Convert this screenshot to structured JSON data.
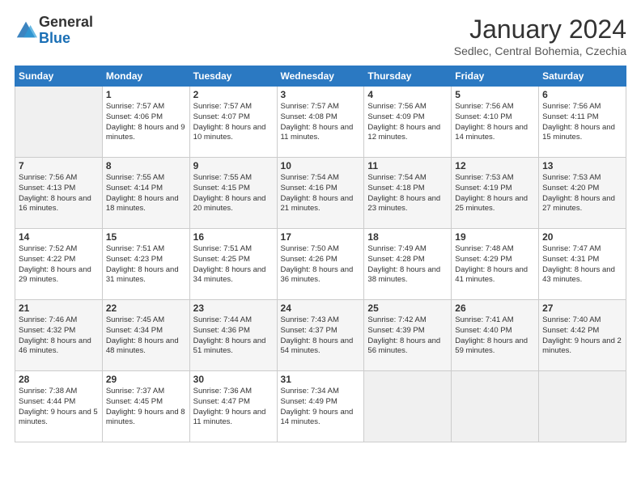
{
  "logo": {
    "general": "General",
    "blue": "Blue"
  },
  "header": {
    "month": "January 2024",
    "location": "Sedlec, Central Bohemia, Czechia"
  },
  "days": [
    "Sunday",
    "Monday",
    "Tuesday",
    "Wednesday",
    "Thursday",
    "Friday",
    "Saturday"
  ],
  "weeks": [
    [
      {
        "num": "",
        "empty": true
      },
      {
        "num": "1",
        "sunrise": "7:57 AM",
        "sunset": "4:06 PM",
        "daylight": "8 hours and 9 minutes."
      },
      {
        "num": "2",
        "sunrise": "7:57 AM",
        "sunset": "4:07 PM",
        "daylight": "8 hours and 10 minutes."
      },
      {
        "num": "3",
        "sunrise": "7:57 AM",
        "sunset": "4:08 PM",
        "daylight": "8 hours and 11 minutes."
      },
      {
        "num": "4",
        "sunrise": "7:56 AM",
        "sunset": "4:09 PM",
        "daylight": "8 hours and 12 minutes."
      },
      {
        "num": "5",
        "sunrise": "7:56 AM",
        "sunset": "4:10 PM",
        "daylight": "8 hours and 14 minutes."
      },
      {
        "num": "6",
        "sunrise": "7:56 AM",
        "sunset": "4:11 PM",
        "daylight": "8 hours and 15 minutes."
      }
    ],
    [
      {
        "num": "7",
        "sunrise": "7:56 AM",
        "sunset": "4:13 PM",
        "daylight": "8 hours and 16 minutes."
      },
      {
        "num": "8",
        "sunrise": "7:55 AM",
        "sunset": "4:14 PM",
        "daylight": "8 hours and 18 minutes."
      },
      {
        "num": "9",
        "sunrise": "7:55 AM",
        "sunset": "4:15 PM",
        "daylight": "8 hours and 20 minutes."
      },
      {
        "num": "10",
        "sunrise": "7:54 AM",
        "sunset": "4:16 PM",
        "daylight": "8 hours and 21 minutes."
      },
      {
        "num": "11",
        "sunrise": "7:54 AM",
        "sunset": "4:18 PM",
        "daylight": "8 hours and 23 minutes."
      },
      {
        "num": "12",
        "sunrise": "7:53 AM",
        "sunset": "4:19 PM",
        "daylight": "8 hours and 25 minutes."
      },
      {
        "num": "13",
        "sunrise": "7:53 AM",
        "sunset": "4:20 PM",
        "daylight": "8 hours and 27 minutes."
      }
    ],
    [
      {
        "num": "14",
        "sunrise": "7:52 AM",
        "sunset": "4:22 PM",
        "daylight": "8 hours and 29 minutes."
      },
      {
        "num": "15",
        "sunrise": "7:51 AM",
        "sunset": "4:23 PM",
        "daylight": "8 hours and 31 minutes."
      },
      {
        "num": "16",
        "sunrise": "7:51 AM",
        "sunset": "4:25 PM",
        "daylight": "8 hours and 34 minutes."
      },
      {
        "num": "17",
        "sunrise": "7:50 AM",
        "sunset": "4:26 PM",
        "daylight": "8 hours and 36 minutes."
      },
      {
        "num": "18",
        "sunrise": "7:49 AM",
        "sunset": "4:28 PM",
        "daylight": "8 hours and 38 minutes."
      },
      {
        "num": "19",
        "sunrise": "7:48 AM",
        "sunset": "4:29 PM",
        "daylight": "8 hours and 41 minutes."
      },
      {
        "num": "20",
        "sunrise": "7:47 AM",
        "sunset": "4:31 PM",
        "daylight": "8 hours and 43 minutes."
      }
    ],
    [
      {
        "num": "21",
        "sunrise": "7:46 AM",
        "sunset": "4:32 PM",
        "daylight": "8 hours and 46 minutes."
      },
      {
        "num": "22",
        "sunrise": "7:45 AM",
        "sunset": "4:34 PM",
        "daylight": "8 hours and 48 minutes."
      },
      {
        "num": "23",
        "sunrise": "7:44 AM",
        "sunset": "4:36 PM",
        "daylight": "8 hours and 51 minutes."
      },
      {
        "num": "24",
        "sunrise": "7:43 AM",
        "sunset": "4:37 PM",
        "daylight": "8 hours and 54 minutes."
      },
      {
        "num": "25",
        "sunrise": "7:42 AM",
        "sunset": "4:39 PM",
        "daylight": "8 hours and 56 minutes."
      },
      {
        "num": "26",
        "sunrise": "7:41 AM",
        "sunset": "4:40 PM",
        "daylight": "8 hours and 59 minutes."
      },
      {
        "num": "27",
        "sunrise": "7:40 AM",
        "sunset": "4:42 PM",
        "daylight": "9 hours and 2 minutes."
      }
    ],
    [
      {
        "num": "28",
        "sunrise": "7:38 AM",
        "sunset": "4:44 PM",
        "daylight": "9 hours and 5 minutes."
      },
      {
        "num": "29",
        "sunrise": "7:37 AM",
        "sunset": "4:45 PM",
        "daylight": "9 hours and 8 minutes."
      },
      {
        "num": "30",
        "sunrise": "7:36 AM",
        "sunset": "4:47 PM",
        "daylight": "9 hours and 11 minutes."
      },
      {
        "num": "31",
        "sunrise": "7:34 AM",
        "sunset": "4:49 PM",
        "daylight": "9 hours and 14 minutes."
      },
      {
        "num": "",
        "empty": true
      },
      {
        "num": "",
        "empty": true
      },
      {
        "num": "",
        "empty": true
      }
    ]
  ]
}
